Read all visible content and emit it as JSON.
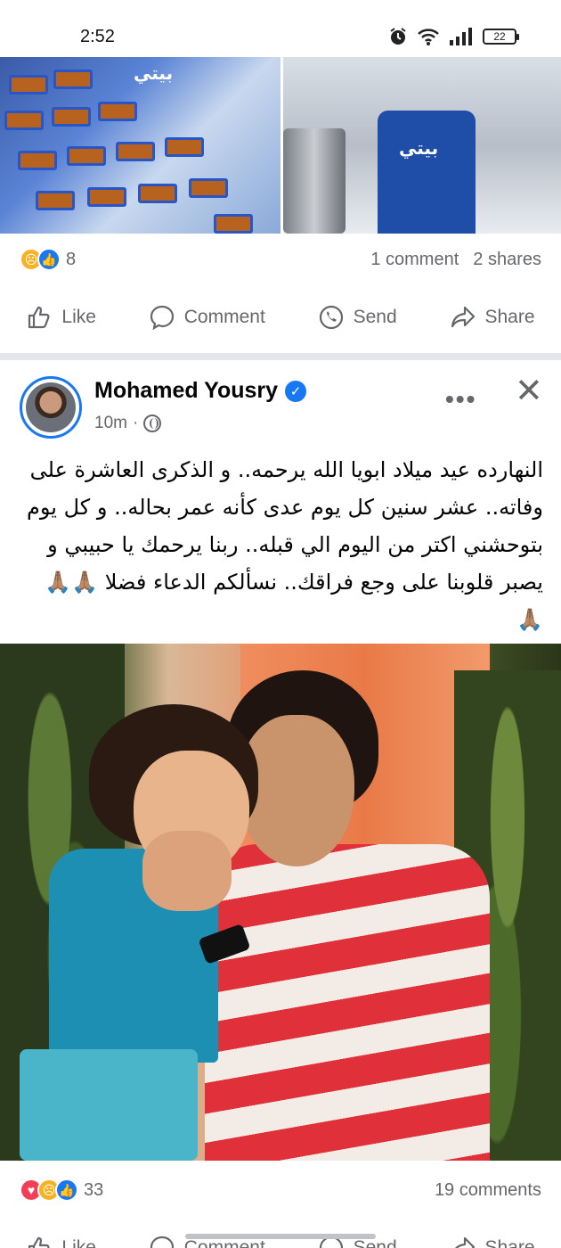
{
  "status_bar": {
    "time": "2:52",
    "battery": "22",
    "icons": [
      "alarm-icon",
      "wifi-icon",
      "signal-icon",
      "battery-icon"
    ]
  },
  "previous_post": {
    "reaction_count": "8",
    "reaction_types": [
      "sad",
      "like"
    ],
    "comments": "1 comment",
    "shares": "2 shares",
    "logo_text": "بيتي"
  },
  "actions": {
    "like": "Like",
    "comment": "Comment",
    "send": "Send",
    "share": "Share"
  },
  "post": {
    "author": "Mohamed Yousry",
    "time": "10m",
    "separator": "·",
    "text": "النهارده عيد ميلاد ابويا الله يرحمه.. و الذكرى العاشرة على وفاته.. عشر سنين كل يوم عدى كأنه عمر بحاله.. و كل يوم بتوحشني اكتر من اليوم الي قبله.. ربنا يرحمك يا حبيبي و يصبر قلوبنا على وجع فراقك.. نسألكم الدعاء فضلا 🙏🏽🙏🏽🙏🏽",
    "reaction_count": "33",
    "reaction_types": [
      "love",
      "sad",
      "like"
    ],
    "comments": "19 comments"
  },
  "colors": {
    "facebook_blue": "#1877f2",
    "secondary_text": "#65676b",
    "divider": "#e4e6eb"
  }
}
